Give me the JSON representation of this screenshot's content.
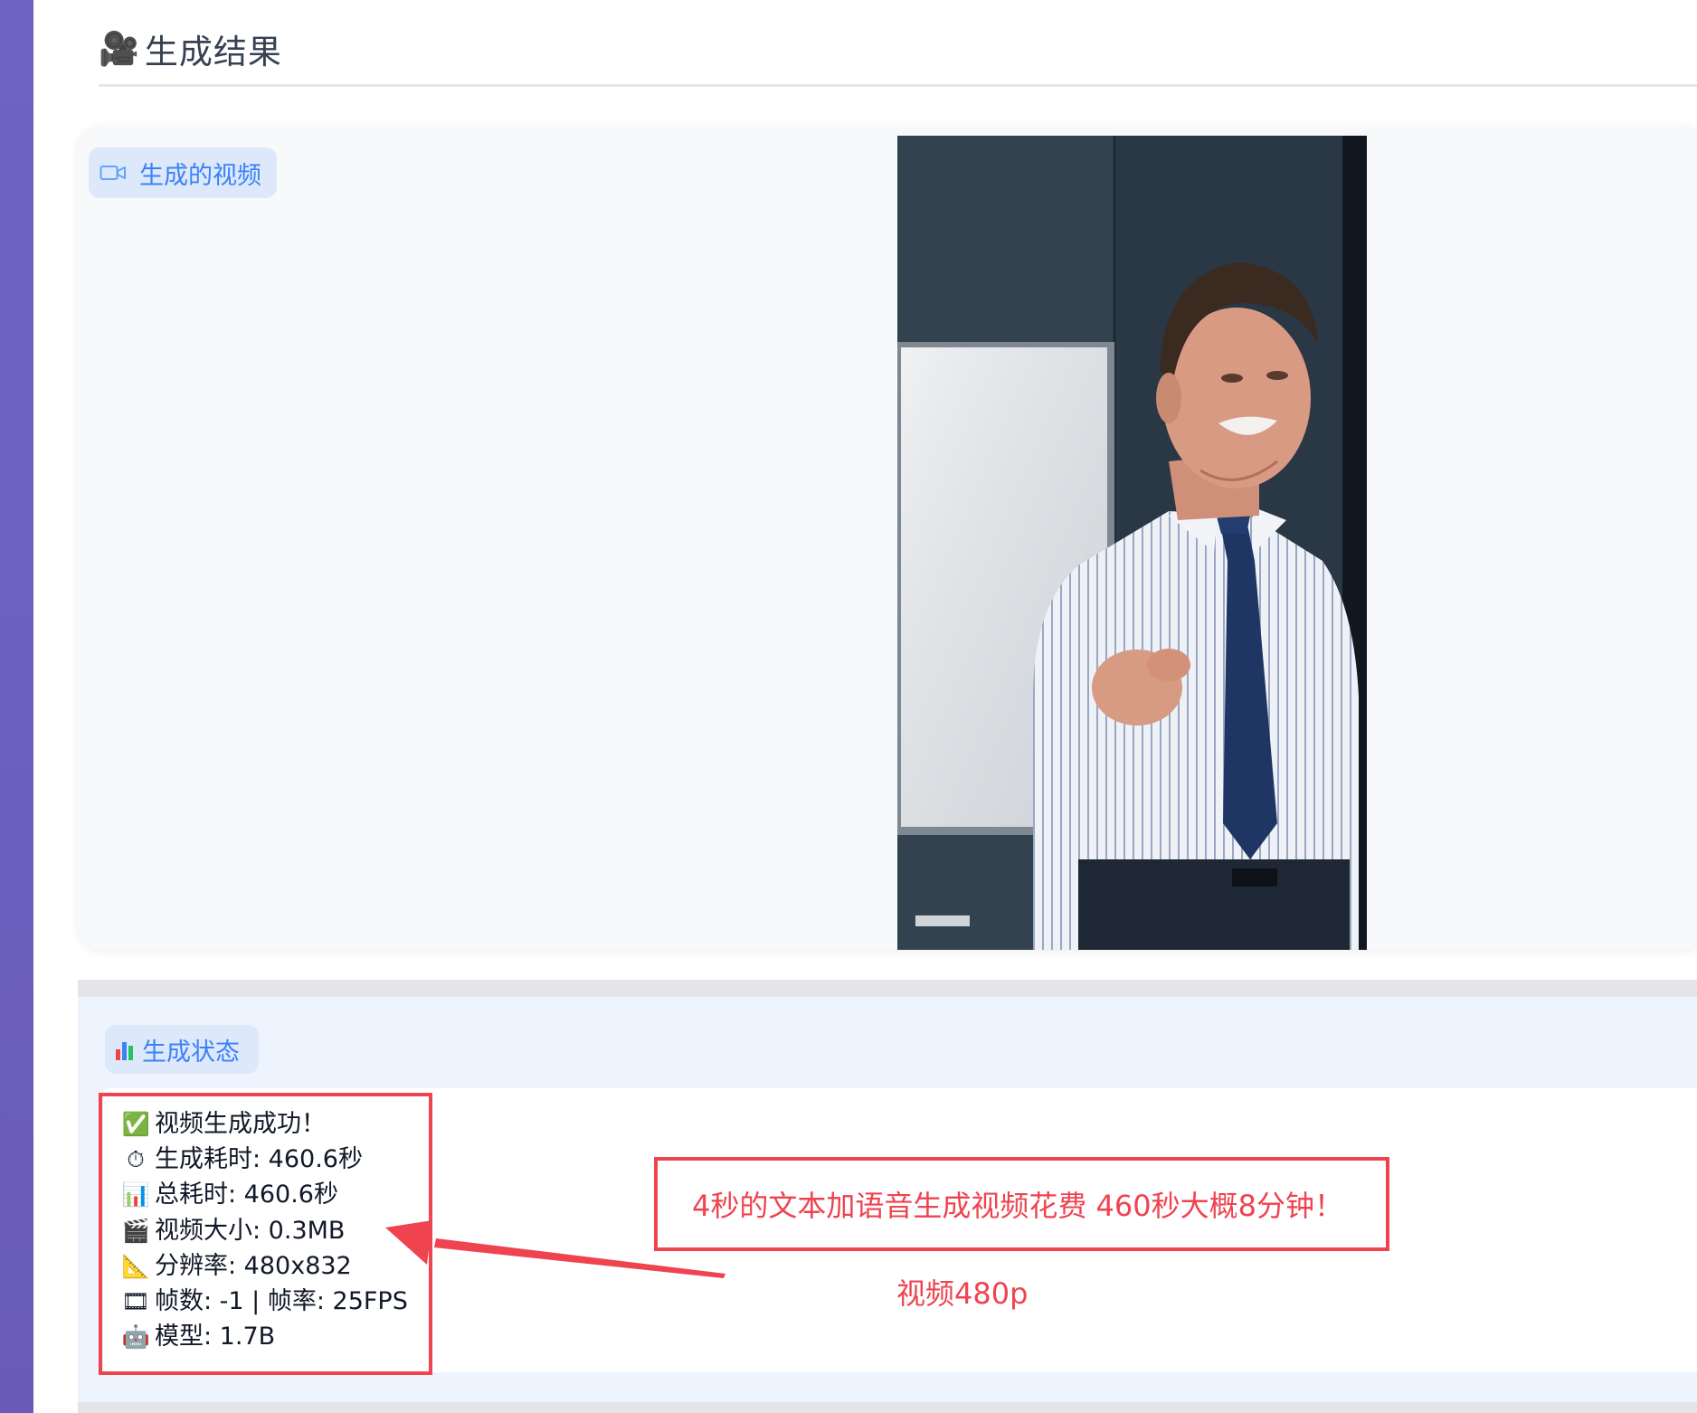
{
  "header": {
    "emoji": "🎥",
    "title": "生成结果"
  },
  "video_section": {
    "label": "生成的视频",
    "icon": "video-camera-icon"
  },
  "status_section": {
    "label": "生成状态",
    "icon": "bar-chart-icon",
    "lines": [
      {
        "icon": "check-mark-icon",
        "emoji": "✅",
        "text": "视频生成成功！"
      },
      {
        "icon": "stopwatch-icon",
        "emoji": "⏱",
        "text": "生成耗时: 460.6秒"
      },
      {
        "icon": "bar-chart-icon",
        "emoji": "📊",
        "text": "总耗时: 460.6秒"
      },
      {
        "icon": "clapper-board-icon",
        "emoji": "🎬",
        "text": "视频大小: 0.3MB"
      },
      {
        "icon": "triangular-ruler-icon",
        "emoji": "📐",
        "text": "分辨率: 480x832"
      },
      {
        "icon": "film-frames-icon",
        "emoji": "🎞",
        "text": "帧数: -1 | 帧率: 25FPS"
      },
      {
        "icon": "robot-icon",
        "emoji": "🤖",
        "text": "模型: 1.7B"
      }
    ]
  },
  "annotation": {
    "main": "4秒的文本加语音生成视频花费 460秒大概8分钟！",
    "sub": "视频480p"
  },
  "colors": {
    "accent": "#3b82f6",
    "annotation": "#ef4350",
    "sidebar": "#6f63c2"
  }
}
